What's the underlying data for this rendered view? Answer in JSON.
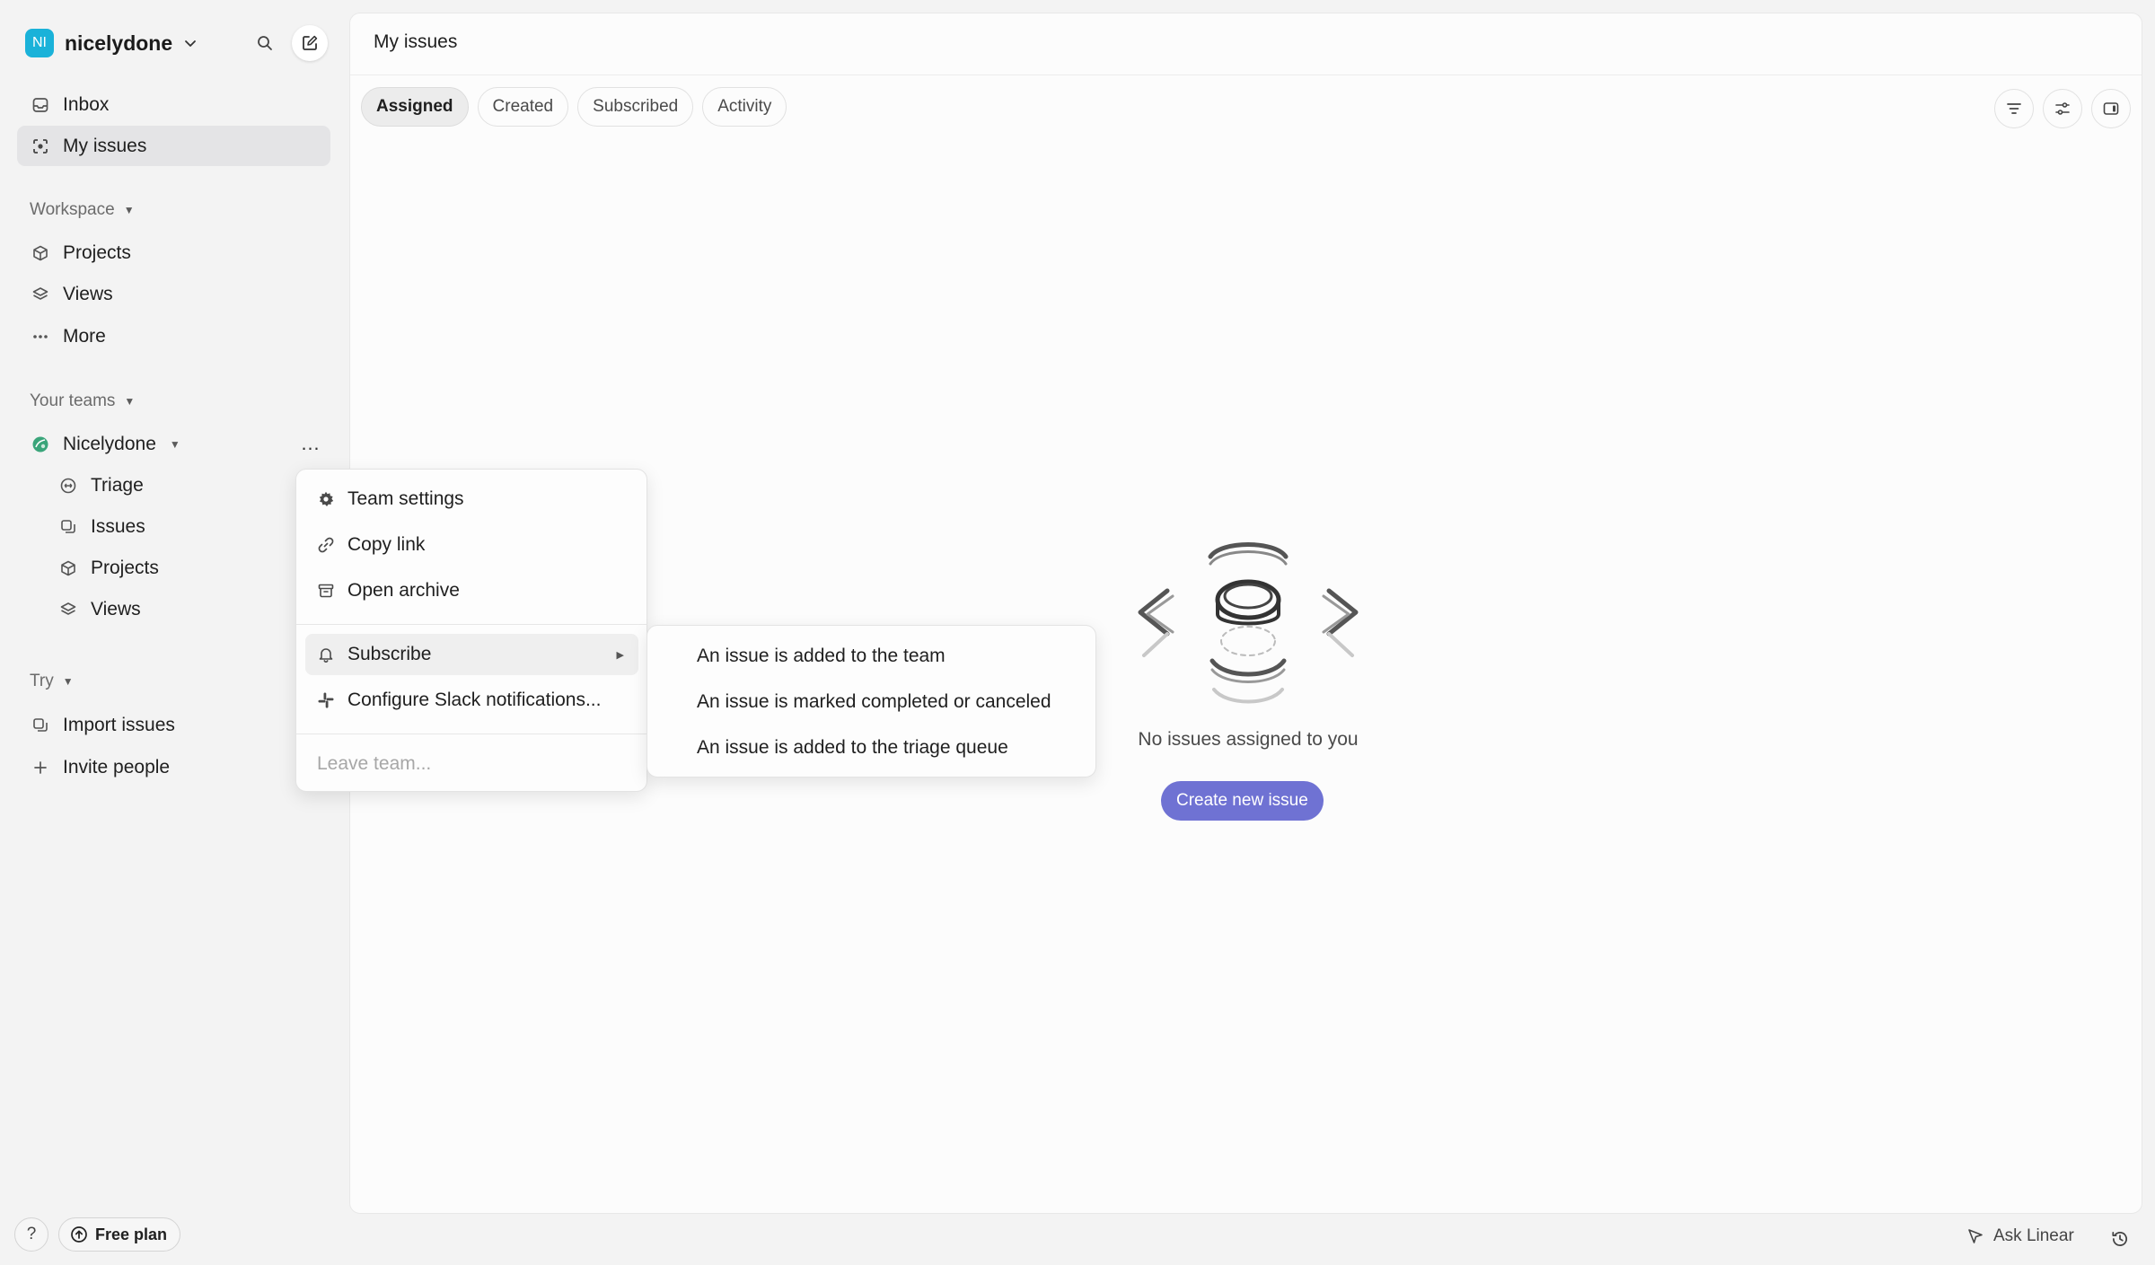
{
  "workspace": {
    "initials": "NI",
    "name": "nicelydone"
  },
  "sidebar": {
    "top_items": [
      {
        "label": "Inbox",
        "icon": "inbox-icon"
      },
      {
        "label": "My issues",
        "icon": "my-issues-icon",
        "active": true
      }
    ],
    "workspace_label": "Workspace",
    "workspace_items": [
      {
        "label": "Projects",
        "icon": "cube-icon"
      },
      {
        "label": "Views",
        "icon": "layers-icon"
      },
      {
        "label": "More",
        "icon": "ellipsis-icon"
      }
    ],
    "teams_label": "Your teams",
    "team": {
      "name": "Nicelydone",
      "more": "…",
      "items": [
        {
          "label": "Triage",
          "icon": "triage-icon"
        },
        {
          "label": "Issues",
          "icon": "issues-icon"
        },
        {
          "label": "Projects",
          "icon": "cube-icon"
        },
        {
          "label": "Views",
          "icon": "layers-icon"
        }
      ]
    },
    "try_label": "Try",
    "try_items": [
      {
        "label": "Import issues",
        "icon": "import-icon"
      },
      {
        "label": "Invite people",
        "icon": "plus-icon"
      }
    ],
    "help": "?",
    "plan": "Free plan"
  },
  "main": {
    "title": "My issues",
    "tabs": [
      "Assigned",
      "Created",
      "Subscribed",
      "Activity"
    ],
    "active_tab": "Assigned",
    "empty_text": "No issues assigned to you",
    "create_button": "Create new issue"
  },
  "context_menu": {
    "items": [
      "Team settings",
      "Copy link",
      "Open archive"
    ],
    "subscribe": "Subscribe",
    "slack": "Configure Slack notifications...",
    "leave": "Leave team..."
  },
  "submenu": {
    "items": [
      "An issue is added to the team",
      "An issue is marked completed or canceled",
      "An issue is added to the triage queue"
    ]
  },
  "bottom": {
    "ask": "Ask Linear"
  },
  "colors": {
    "accent": "#6f72d3",
    "avatar": "#1ab2d9",
    "team_icon": "#3aa57a"
  }
}
